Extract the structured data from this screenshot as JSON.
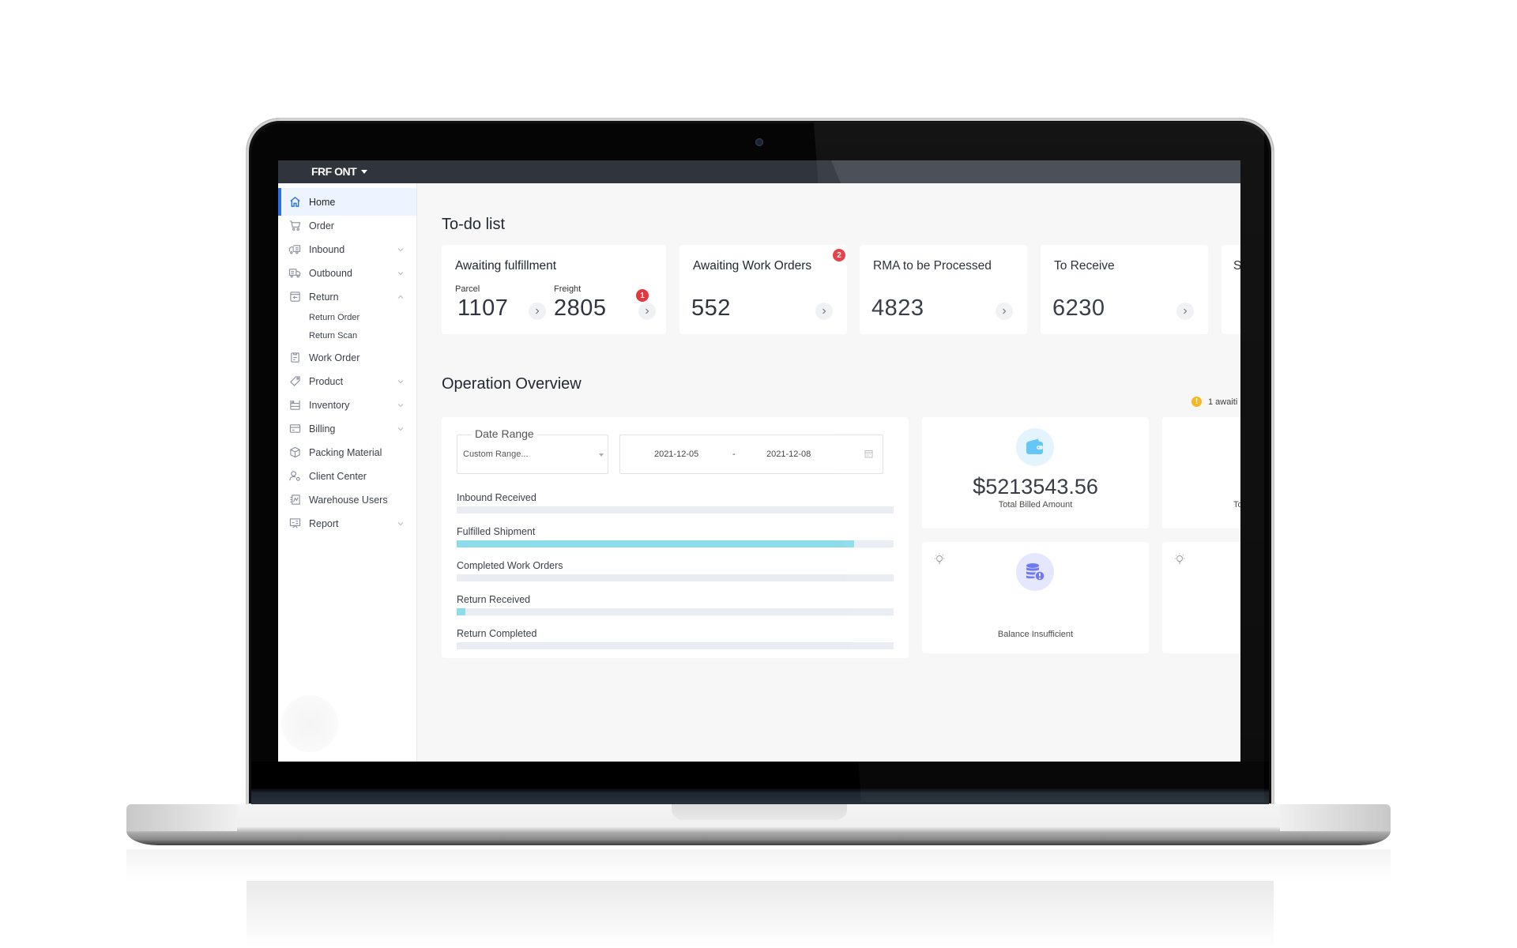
{
  "header": {
    "workspace": "FRF ONT"
  },
  "sidebar": {
    "items": [
      {
        "label": "Home",
        "icon": "home-icon",
        "active": true
      },
      {
        "label": "Order",
        "icon": "cart-icon"
      },
      {
        "label": "Inbound",
        "icon": "inbound-truck-icon",
        "expandable": true
      },
      {
        "label": "Outbound",
        "icon": "outbound-truck-icon",
        "expandable": true
      },
      {
        "label": "Return",
        "icon": "return-icon",
        "expandable": true,
        "expanded": true,
        "children": [
          {
            "label": "Return Order"
          },
          {
            "label": "Return Scan"
          }
        ]
      },
      {
        "label": "Work Order",
        "icon": "clipboard-icon"
      },
      {
        "label": "Product",
        "icon": "tag-icon",
        "expandable": true
      },
      {
        "label": "Inventory",
        "icon": "shelf-icon",
        "expandable": true
      },
      {
        "label": "Billing",
        "icon": "card-icon",
        "expandable": true
      },
      {
        "label": "Packing Material",
        "icon": "box-icon"
      },
      {
        "label": "Client Center",
        "icon": "user-gear-icon"
      },
      {
        "label": "Warehouse Users",
        "icon": "users-list-icon"
      },
      {
        "label": "Report",
        "icon": "presentation-icon",
        "expandable": true
      }
    ]
  },
  "todo": {
    "title": "To-do list",
    "cards": [
      {
        "title": "Awaiting fulfillment",
        "sub": [
          {
            "label": "Parcel",
            "value": "1107"
          },
          {
            "label": "Freight",
            "value": "2805",
            "badge": "1"
          }
        ]
      },
      {
        "title": "Awaiting Work Orders",
        "value": "552",
        "badge": "2"
      },
      {
        "title": "RMA to be Processed",
        "value": "4823"
      },
      {
        "title": "To Receive",
        "value": "6230"
      },
      {
        "title": "S"
      }
    ]
  },
  "overview": {
    "title": "Operation Overview",
    "date_range_legend": "Date Range",
    "date_range_select": "Custom Range...",
    "start_date": "2021-12-05",
    "separator": "-",
    "end_date": "2021-12-08",
    "metrics": [
      {
        "label": "Inbound Received",
        "progress": 0
      },
      {
        "label": "Fulfilled Shipment",
        "progress": 0.91
      },
      {
        "label": "Completed Work Orders",
        "progress": 0
      },
      {
        "label": "Return Received",
        "progress": 0.02
      },
      {
        "label": "Return Completed",
        "progress": 0
      }
    ],
    "billed_symbol": "$",
    "billed_amount": "5213543.56",
    "billed_caption": "Total Billed Amount",
    "balance_caption": "Balance Insufficient",
    "awaiting_note": "1 awaiti",
    "partial_caption": "To",
    "warn_glyph": "!"
  },
  "colors": {
    "accent": "#2f6fe6",
    "progress": "#8ddceb",
    "badge": "#e5373f",
    "warning": "#f7b21b"
  }
}
